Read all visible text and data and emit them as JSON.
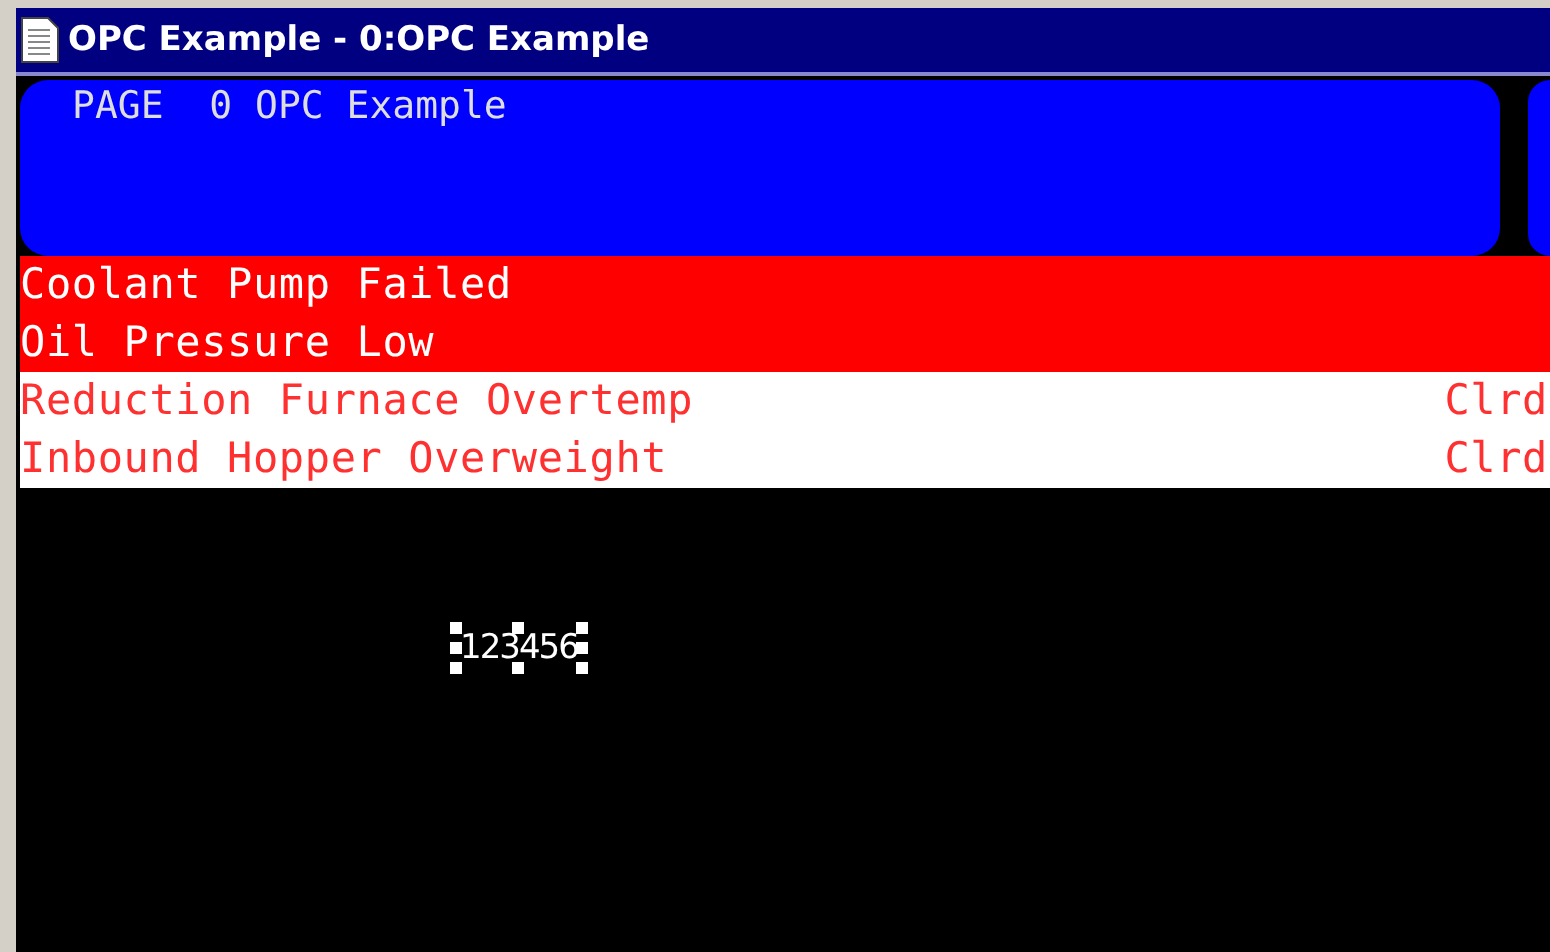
{
  "window": {
    "title": "OPC Example - 0:OPC Example"
  },
  "header": {
    "title": "PAGE  0 OPC Example"
  },
  "alarms": [
    {
      "message": "Coolant Pump Failed",
      "kind": "active"
    },
    {
      "message": "Oil Pressure Low",
      "kind": "active"
    },
    {
      "message": "Reduction Furnace Overtemp",
      "kind": "cleared",
      "status": "Clrd"
    },
    {
      "message": "Inbound Hopper Overweight",
      "kind": "cleared",
      "status": "Clrd"
    }
  ],
  "value_field": {
    "value": "123456",
    "selected": true
  }
}
